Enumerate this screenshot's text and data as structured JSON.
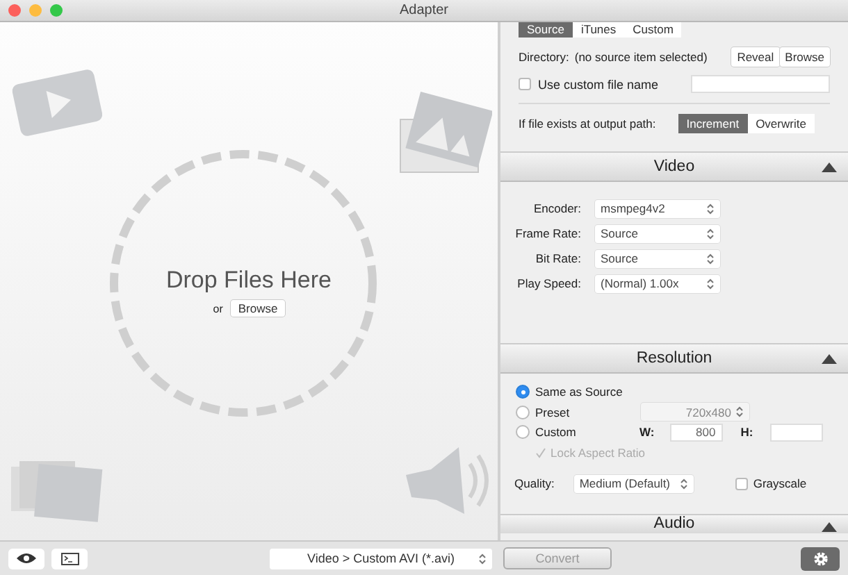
{
  "window": {
    "title": "Adapter"
  },
  "drop_zone": {
    "title": "Drop Files Here",
    "or_label": "or",
    "browse_button": "Browse"
  },
  "output": {
    "tabs": [
      {
        "label": "Source",
        "selected": true
      },
      {
        "label": "iTunes",
        "selected": false
      },
      {
        "label": "Custom",
        "selected": false
      }
    ],
    "directory_label": "Directory:",
    "directory_value": "(no source item selected)",
    "buttons": [
      "Reveal",
      "Browse"
    ],
    "custom_name": {
      "label": "Use custom file name",
      "checked": false
    },
    "exists_label": "If file exists at output path:",
    "exists_options": [
      {
        "label": "Increment",
        "selected": true
      },
      {
        "label": "Overwrite",
        "selected": false
      }
    ]
  },
  "video": {
    "header": "Video",
    "fields": [
      {
        "label": "Encoder:",
        "value": "msmpeg4v2"
      },
      {
        "label": "Frame Rate:",
        "value": "Source"
      },
      {
        "label": "Bit Rate:",
        "value": "Source"
      },
      {
        "label": "Play Speed:",
        "value": "(Normal) 1.00x"
      }
    ]
  },
  "resolution": {
    "header": "Resolution",
    "options": [
      {
        "label": "Same as Source",
        "selected": true
      },
      {
        "label": "Preset",
        "selected": false
      },
      {
        "label": "Custom",
        "selected": false
      }
    ],
    "preset_value": "720x480",
    "width_label": "W:",
    "width_value": "800",
    "height_label": "H:",
    "lock_aspect": {
      "label": "Lock Aspect Ratio",
      "checked": true,
      "disabled": true
    },
    "quality_label": "Quality:",
    "quality_value": "Medium (Default)",
    "grayscale": {
      "label": "Grayscale",
      "checked": false
    }
  },
  "audio": {
    "header": "Audio"
  },
  "toolbar": {
    "format": "Video > Custom AVI (*.avi)",
    "convert_button": {
      "label": "Convert",
      "disabled": true
    }
  }
}
